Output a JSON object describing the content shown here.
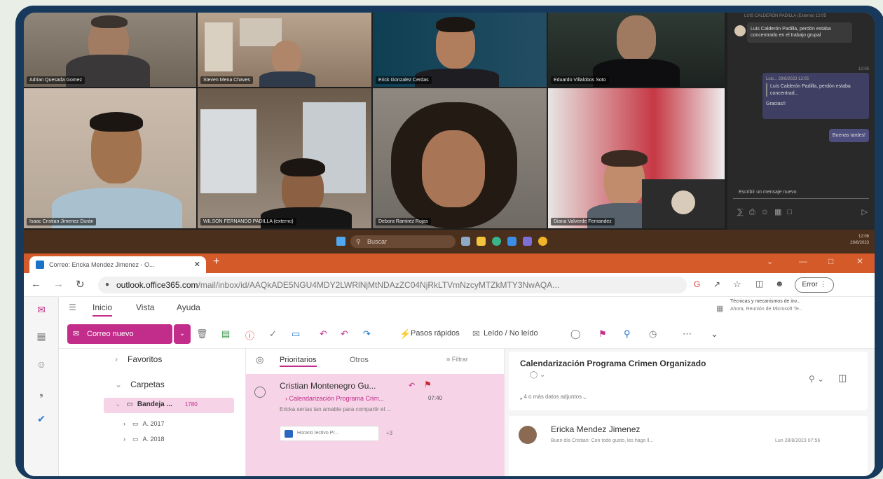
{
  "meeting": {
    "participants": [
      {
        "name": "Adrian Quesada Gomez"
      },
      {
        "name": "Steven Mena Chaves"
      },
      {
        "name": "Erick Gonzalez Cerdas"
      },
      {
        "name": "Eduardo Villalobos Soto"
      },
      {
        "name": "Isaac Cristian Jimenez Durán"
      },
      {
        "name": "WILSON FERNANDO PADILLA (externo)"
      },
      {
        "name": "Debora Ramirez Rojas"
      },
      {
        "name": "Diana Valverde Fernandez"
      }
    ],
    "chat": {
      "header": "LUIS CALDERÓN PADILLA (Externo) 12:05",
      "msg1": "Luis Calderón Padilla, perdón estaba concentrado en el trabajo grupal",
      "time2": "12:05",
      "quote_head": "Luis... 29/8/2023 12:05",
      "quote_body": "Luis Calderón Padilla, perdón estaba concentrad...",
      "reply1": "Gracias!!",
      "reply2": "Buenas tardes!",
      "compose_placeholder": "Escribir un mensaje nuevo"
    }
  },
  "taskbar": {
    "search_label": "Buscar",
    "clock_time": "12:06",
    "clock_date": "29/8/2023"
  },
  "browser": {
    "tab_title": "Correo: Ericka Mendez Jimenez - O...",
    "url_domain": "outlook.office365.com",
    "url_path": "/mail/inbox/id/AAQkADE5NGU4MDY2LWRlNjMtNDAzZC04NjRkLTVmNzcyMTZkMTY3NwAQA...",
    "error_label": "Error",
    "colors": {
      "tabstrip": "#d55a2a",
      "accent": "#c22c8a"
    }
  },
  "outlook": {
    "tabs": [
      "Inicio",
      "Vista",
      "Ayuda"
    ],
    "notification_title": "Técnicas y mecanismos de inv...",
    "notification_sub": "Ahora, Reunión de Microsoft Te...",
    "new_mail_label": "Correo nuevo",
    "quick_steps_label": "Pasos rápidos",
    "read_unread_label": "Leído / No leído",
    "folders": {
      "favorites": "Favoritos",
      "folders": "Carpetas",
      "inbox": "Bandeja ...",
      "inbox_count": "1780",
      "sub1": "A. 2017",
      "sub2": "A. 2018"
    },
    "list": {
      "focused": "Prioritarios",
      "other": "Otros",
      "filter": "Filtrar",
      "sender": "Cristian Montenegro Gu...",
      "subject": "Calendarización Programa Crim...",
      "time": "07:40",
      "preview": "Ericka serías tan amable para compartir el ...",
      "attachment": "Horario lectivo Pr...",
      "more": "+3"
    },
    "reading": {
      "subject": "Calendarización Programa Crimen Organizado",
      "attachments": "4 o más datos adjuntos",
      "sender": "Ericka Mendez Jimenez",
      "preview": "Buen día Cristian: Con todo gusto, les hago ll...",
      "date": "Lun 28/8/2023 07:56"
    }
  }
}
